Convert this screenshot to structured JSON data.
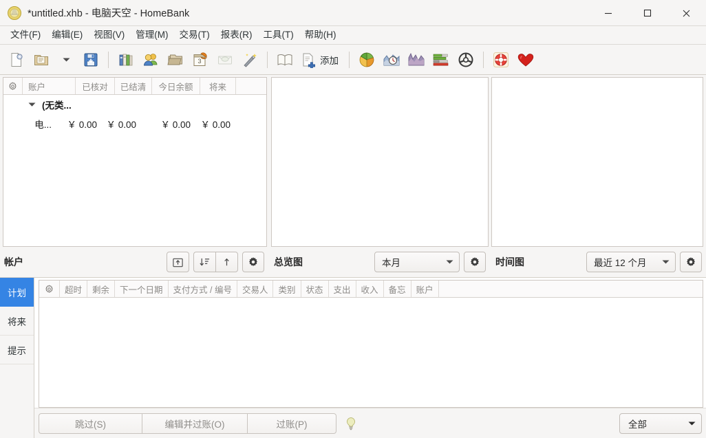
{
  "window": {
    "title": "*untitled.xhb - 电脑天空 - HomeBank",
    "app_icon": "homebank-logo-icon",
    "controls": {
      "minimize": "minimize-icon",
      "maximize": "maximize-icon",
      "close": "close-icon"
    }
  },
  "menubar": {
    "items": [
      {
        "label": "文件(F)"
      },
      {
        "label": "编辑(E)"
      },
      {
        "label": "视图(V)"
      },
      {
        "label": "管理(M)"
      },
      {
        "label": "交易(T)"
      },
      {
        "label": "报表(R)"
      },
      {
        "label": "工具(T)"
      },
      {
        "label": "帮助(H)"
      }
    ]
  },
  "toolbar": {
    "add_label": "添加",
    "buttons": [
      {
        "name": "new-file-icon"
      },
      {
        "name": "open-file-icon"
      },
      {
        "name": "open-dropdown-arrow-icon"
      },
      {
        "name": "save-file-icon"
      },
      {
        "name": "accounts-icon"
      },
      {
        "name": "payees-icon"
      },
      {
        "name": "categories-icon"
      },
      {
        "name": "scheduled-icon"
      },
      {
        "name": "budget-icon"
      },
      {
        "name": "assignments-icon"
      },
      {
        "name": "ledger-icon"
      },
      {
        "name": "add-transaction-icon"
      },
      {
        "name": "statistics-pie-icon"
      },
      {
        "name": "trend-time-icon"
      },
      {
        "name": "balance-chart-icon"
      },
      {
        "name": "budget-report-icon"
      },
      {
        "name": "vehicle-cost-icon"
      },
      {
        "name": "help-lifering-icon"
      },
      {
        "name": "donate-heart-icon"
      }
    ]
  },
  "accounts_panel": {
    "title": "帐户",
    "columns": [
      "账户",
      "已核对",
      "已结清",
      "今日余额",
      "将来"
    ],
    "gear_header_icon": "gear-icon",
    "rows": [
      {
        "type": "group",
        "expander": "expanded",
        "name": "(无类..."
      },
      {
        "type": "account",
        "name": "电...",
        "reconciled": "￥ 0.00",
        "cleared": "￥ 0.00",
        "today": "￥ 0.00",
        "future": "￥ 0.00"
      }
    ],
    "buttons": [
      {
        "name": "show-account-icon"
      },
      {
        "name": "collapse-all-icon"
      },
      {
        "name": "expand-all-icon"
      },
      {
        "name": "settings-gear-icon"
      }
    ]
  },
  "overview_panel": {
    "title": "总览图",
    "range": "本月",
    "gear_icon": "gear-icon",
    "dropdown_icon": "chevron-down-icon"
  },
  "timeline_panel": {
    "title": "时间图",
    "range": "最近 12 个月",
    "gear_icon": "gear-icon",
    "dropdown_icon": "chevron-down-icon"
  },
  "bottom_panel": {
    "tabs": [
      {
        "label": "计划",
        "active": true
      },
      {
        "label": "将来",
        "active": false
      },
      {
        "label": "提示",
        "active": false
      }
    ],
    "columns": [
      "超时",
      "剩余",
      "下一个日期",
      "支付方式 / 编号",
      "交易人",
      "类别",
      "状态",
      "支出",
      "收入",
      "备忘",
      "账户"
    ],
    "gear_header_icon": "gear-icon",
    "rows": [],
    "actions": [
      {
        "label": "跳过(S)",
        "enabled": false
      },
      {
        "label": "编辑并过账(O)",
        "enabled": false
      },
      {
        "label": "过账(P)",
        "enabled": false
      }
    ],
    "hint_icon": "lightbulb-icon",
    "filter": "全部",
    "filter_dropdown_icon": "chevron-down-icon"
  },
  "colors": {
    "accent": "#3584e4",
    "chrome": "#f6f5f4",
    "border": "#cdc7c2",
    "text": "#2e3436",
    "muted": "#8d8b88"
  }
}
